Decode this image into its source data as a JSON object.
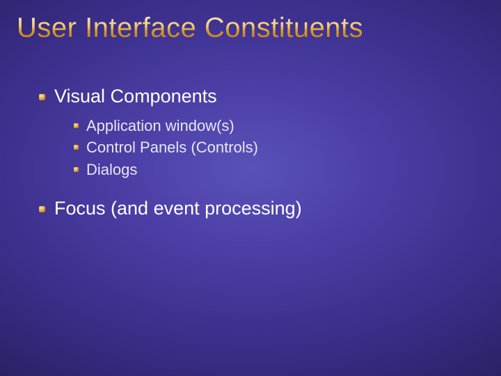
{
  "title": "User Interface Constituents",
  "bullets": [
    {
      "label": "Visual Components",
      "children": [
        {
          "label": "Application window(s)"
        },
        {
          "label": "Control Panels (Controls)"
        },
        {
          "label": "Dialogs"
        }
      ]
    },
    {
      "label": "Focus (and event processing)"
    }
  ]
}
